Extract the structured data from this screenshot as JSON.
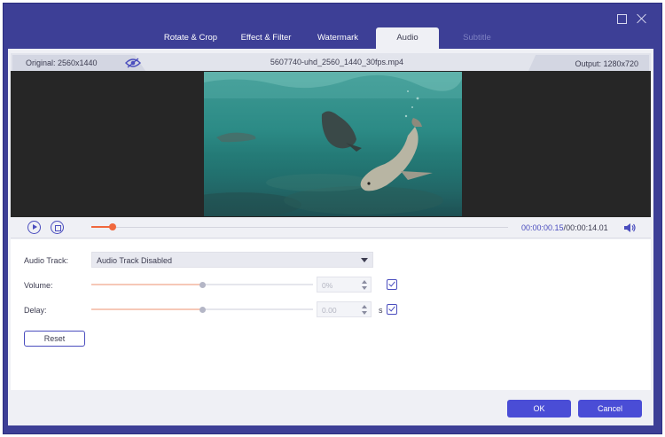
{
  "tabs": [
    {
      "label": "Rotate & Crop",
      "state": "normal"
    },
    {
      "label": "Effect & Filter",
      "state": "normal"
    },
    {
      "label": "Watermark",
      "state": "normal"
    },
    {
      "label": "Audio",
      "state": "active"
    },
    {
      "label": "Subtitle",
      "state": "disabled"
    }
  ],
  "window_controls": {
    "maximize_icon": "square-icon",
    "close_icon": "x-icon"
  },
  "info": {
    "original": "Original: 2560x1440",
    "filename": "5607740-uhd_2560_1440_30fps.mp4",
    "output": "Output: 1280x720",
    "preview_toggle_icon": "eye-icon"
  },
  "playback": {
    "current_time": "00:00:00.15",
    "separator": "/",
    "total_time": "00:00:14.01",
    "progress": 0.05,
    "play_icon": "play-circle-icon",
    "stop_icon": "stop-circle-icon",
    "volume_icon": "speaker-icon"
  },
  "audio": {
    "track_label": "Audio Track:",
    "track_value": "Audio Track Disabled",
    "volume_label": "Volume:",
    "volume_value": "0%",
    "volume_level": 0.5,
    "delay_label": "Delay:",
    "delay_value": "0.00",
    "delay_level": 0.5,
    "delay_unit": "s",
    "reset_label": "Reset"
  },
  "footer": {
    "ok_label": "OK",
    "cancel_label": "Cancel"
  },
  "colors": {
    "frame": "#3d3f96",
    "accent": "#4a4dd6",
    "progress": "#f0683d",
    "slider_fill": "#f6c8b7"
  }
}
